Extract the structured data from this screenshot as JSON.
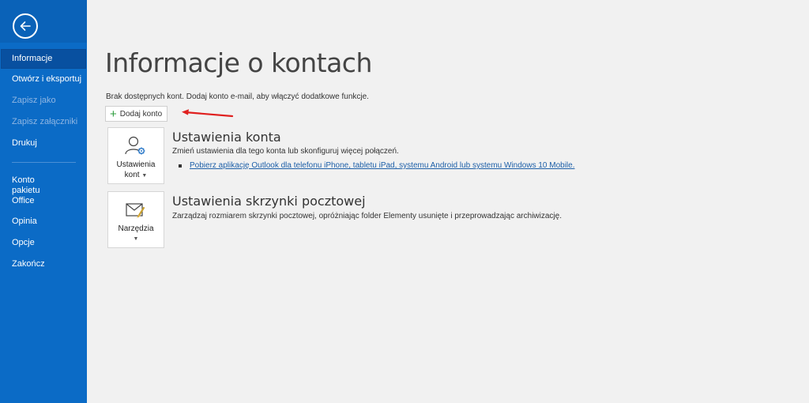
{
  "sidebar": {
    "back_icon": "back-arrow-icon",
    "items": [
      {
        "label": "Informacje",
        "state": "active"
      },
      {
        "label": "Otwórz i eksportuj",
        "state": "normal"
      },
      {
        "label": "Zapisz jako",
        "state": "disabled"
      },
      {
        "label": "Zapisz załączniki",
        "state": "disabled"
      },
      {
        "label": "Drukuj",
        "state": "normal"
      },
      {
        "label": "Konto pakietu Office",
        "state": "normal"
      },
      {
        "label": "Opinia",
        "state": "normal"
      },
      {
        "label": "Opcje",
        "state": "normal"
      },
      {
        "label": "Zakończ",
        "state": "normal"
      }
    ]
  },
  "main": {
    "title": "Informacje o kontach",
    "no_accounts_text": "Brak dostępnych kont. Dodaj konto e-mail, aby włączyć dodatkowe funkcje.",
    "add_account_label": "Dodaj konto",
    "account_settings": {
      "tile_label_line1": "Ustawienia",
      "tile_label_line2": "kont",
      "title": "Ustawienia konta",
      "description": "Zmień ustawienia dla tego konta lub skonfiguruj więcej połączeń.",
      "link": "Pobierz aplikację Outlook dla telefonu iPhone, tabletu iPad, systemu Android lub systemu Windows 10 Mobile."
    },
    "mailbox_settings": {
      "tile_label": "Narzędzia",
      "title": "Ustawienia skrzynki pocztowej",
      "description": "Zarządzaj rozmiarem skrzynki pocztowej, opróżniając folder Elementy usunięte i przeprowadzając archiwizację."
    }
  },
  "colors": {
    "sidebar_bg": "#0b6bc6",
    "accent_arrow": "#e0201f",
    "link": "#1d5fa8",
    "plus": "#2d9c3d"
  }
}
